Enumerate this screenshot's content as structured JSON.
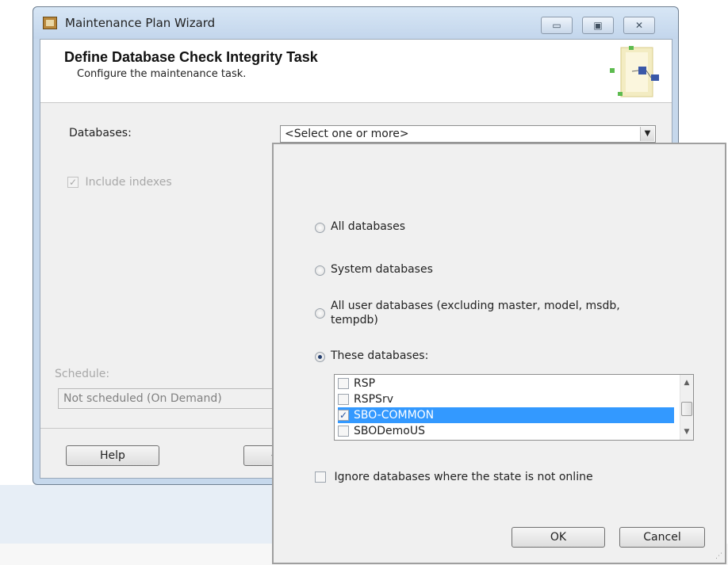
{
  "window": {
    "title": "Maintenance Plan Wizard",
    "minimize_glyph": "▭",
    "maximize_glyph": "▣",
    "close_glyph": "✕"
  },
  "header": {
    "title": "Define Database Check Integrity Task",
    "subtitle": "Configure the maintenance task."
  },
  "form": {
    "databases_label": "Databases:",
    "databases_value": "<Select one or more>",
    "include_indexes_label": "Include indexes",
    "include_indexes_checked": true,
    "schedule_label": "Schedule:",
    "schedule_value": "Not scheduled (On Demand)"
  },
  "buttons": {
    "help": "Help",
    "back_partial": "<"
  },
  "popup": {
    "options": [
      {
        "label": "All databases",
        "selected": false
      },
      {
        "label": "System databases",
        "selected": false
      },
      {
        "label": "All user databases  (excluding master, model, msdb,",
        "label2": "tempdb)",
        "selected": false
      },
      {
        "label": "These databases:",
        "selected": true
      }
    ],
    "databases": [
      {
        "name": "RSP",
        "checked": false,
        "selected": false
      },
      {
        "name": "RSPSrv",
        "checked": false,
        "selected": false
      },
      {
        "name": "SBO-COMMON",
        "checked": true,
        "selected": true
      },
      {
        "name": "SBODemoUS",
        "checked": false,
        "selected": false
      }
    ],
    "ignore_offline_label": "Ignore databases where the state is not online",
    "ignore_offline_checked": false,
    "ok_label": "OK",
    "cancel_label": "Cancel"
  },
  "icons": {
    "check": "✓",
    "dropdown_arrow": "▼",
    "scroll_up": "▲",
    "scroll_down": "▼"
  },
  "colors": {
    "selection": "#3399ff",
    "titlebar": "#c6d8ec"
  }
}
